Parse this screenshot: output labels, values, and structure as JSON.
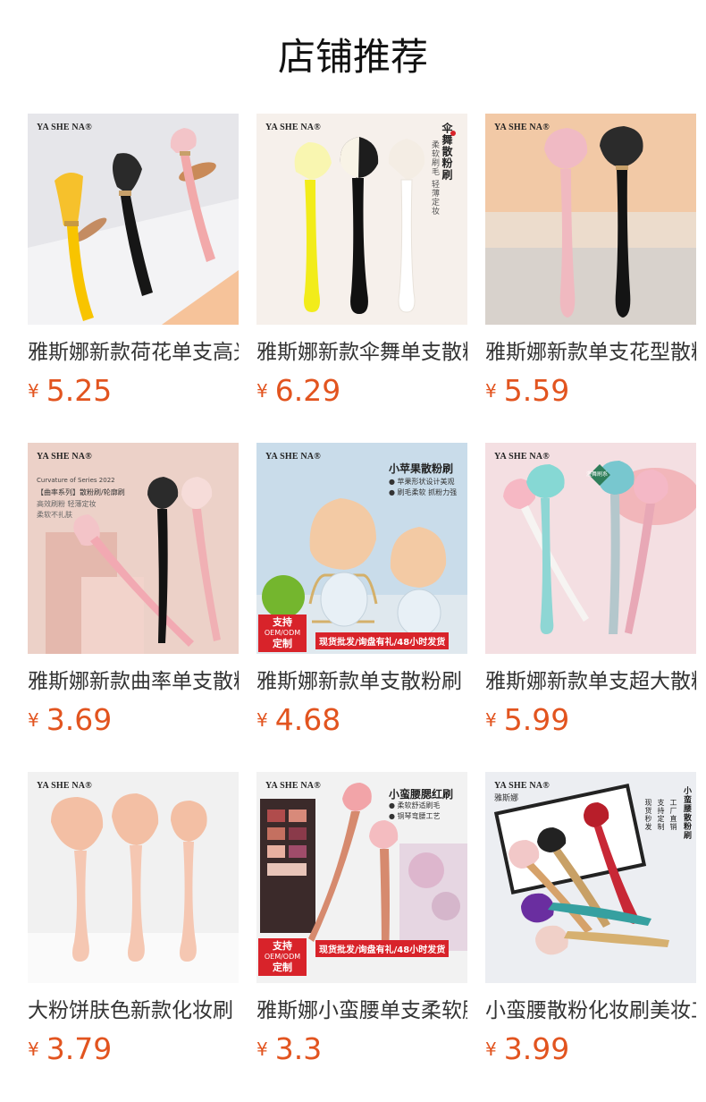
{
  "header": {
    "title": "店铺推荐"
  },
  "colors": {
    "price": "#e2541f",
    "promo_red": "#d8232a"
  },
  "products": [
    {
      "name": "雅斯娜新款荷花单支高光散粉刷",
      "price_symbol": "¥",
      "price": "5.25",
      "image": {
        "brand": "YA SHE NA®"
      }
    },
    {
      "name": "雅斯娜新款伞舞单支散粉刷",
      "price_symbol": "¥",
      "price": "6.29",
      "image": {
        "brand": "YA SHE NA®",
        "vertical_title": "伞舞散粉刷",
        "vertical_sub": "柔软刷毛 轻薄定妆"
      }
    },
    {
      "name": "雅斯娜新款单支花型散粉刷",
      "price_symbol": "¥",
      "price": "5.59",
      "image": {
        "brand": "YA SHE NA®"
      }
    },
    {
      "name": "雅斯娜新款曲率单支散粉刷",
      "price_symbol": "¥",
      "price": "3.69",
      "image": {
        "brand": "YA SHE NA®",
        "series": "Curvature of Series 2022",
        "series_cn": "【曲率系列】散粉刷/轮廓刷",
        "line1": "高效刷粉 轻薄定妆",
        "line2": "柔软不扎肤"
      }
    },
    {
      "name": "雅斯娜新款单支散粉刷",
      "price_symbol": "¥",
      "price": "4.68",
      "image": {
        "brand": "YA SHE NA®",
        "title": "小苹果散粉刷",
        "bullet1": "苹果形状设计美观",
        "bullet2": "刷毛柔软 抓粉力强",
        "oem_top": "支持",
        "oem_mid": "OEM/ODM",
        "oem_bottom": "定制",
        "banner": "现货批发/询盘有礼/48小时发货"
      }
    },
    {
      "name": "雅斯娜新款单支超大散粉刷",
      "price_symbol": "¥",
      "price": "5.99",
      "image": {
        "brand": "YA SHE NA®",
        "badge": "漫舞刷系"
      }
    },
    {
      "name": "大粉饼肤色新款化妆刷",
      "price_symbol": "¥",
      "price": "3.79",
      "image": {
        "brand": "YA SHE NA®"
      }
    },
    {
      "name": "雅斯娜小蛮腰单支柔软腮红刷",
      "price_symbol": "¥",
      "price": "3.3",
      "image": {
        "brand": "YA SHE NA®",
        "title": "小蛮腰腮红刷",
        "bullet1": "柔软舒适刷毛",
        "bullet2": "铜琴弯腰工艺",
        "oem_top": "支持",
        "oem_mid": "OEM/ODM",
        "oem_bottom": "定制",
        "banner": "现货批发/询盘有礼/48小时发货"
      }
    },
    {
      "name": "小蛮腰散粉化妆刷美妆工具",
      "price_symbol": "¥",
      "price": "3.99",
      "image": {
        "brand": "YA SHE NA®",
        "brand_cn": "雅斯娜",
        "vertical_title": "小蛮腰散粉刷",
        "col1": "工厂直销",
        "col2": "支持定制",
        "col3": "现货秒发"
      }
    }
  ]
}
